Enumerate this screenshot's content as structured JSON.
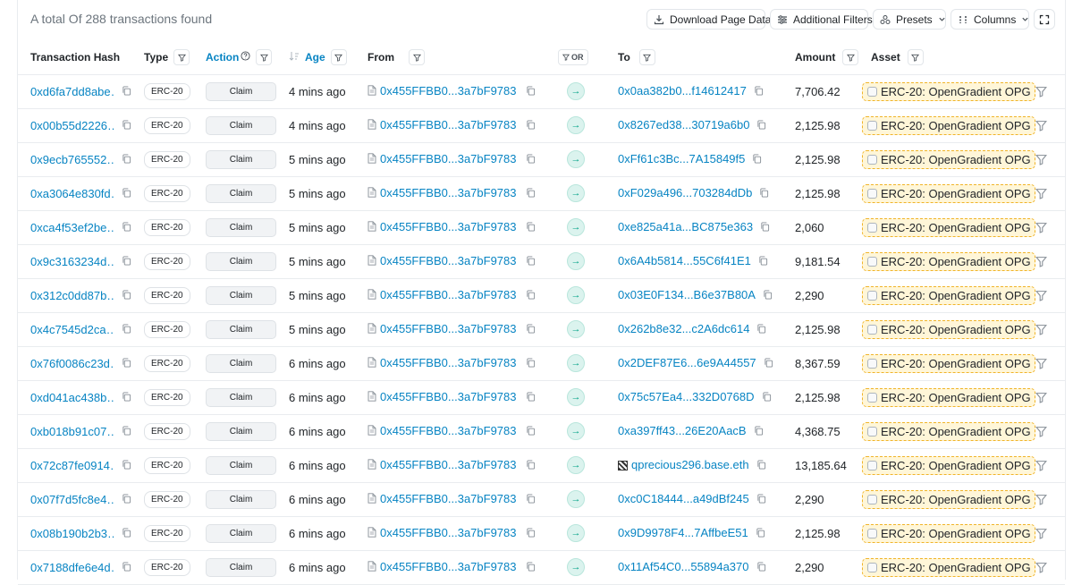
{
  "header": {
    "total_text": "A total Of 288 transactions found",
    "download_label": "Download Page Data",
    "filters_label": "Additional Filters",
    "presets_label": "Presets",
    "columns_label": "Columns"
  },
  "columns": {
    "hash": "Transaction Hash",
    "type": "Type",
    "action": "Action",
    "age": "Age",
    "from": "From",
    "or": "OR",
    "to": "To",
    "amount": "Amount",
    "asset": "Asset"
  },
  "colors": {
    "link": "#0784c3",
    "accent_in": "#00a186",
    "asset_bg": "#fff6d8"
  },
  "rows": [
    {
      "hash": "0xd6fa7dd8abe…",
      "type": "ERC-20",
      "action": "Claim",
      "age": "4 mins ago",
      "from": "0x455FFBB0...3a7bF9783",
      "to": "0x0aa382b0...f14612417",
      "amount": "7,706.42",
      "asset": "ERC-20: OpenGradient OPG"
    },
    {
      "hash": "0x00b55d2226…",
      "type": "ERC-20",
      "action": "Claim",
      "age": "4 mins ago",
      "from": "0x455FFBB0...3a7bF9783",
      "to": "0x8267ed38...30719a6b0",
      "amount": "2,125.98",
      "asset": "ERC-20: OpenGradient OPG"
    },
    {
      "hash": "0x9ecb765552…",
      "type": "ERC-20",
      "action": "Claim",
      "age": "5 mins ago",
      "from": "0x455FFBB0...3a7bF9783",
      "to": "0xFf61c3Bc...7A15849f5",
      "amount": "2,125.98",
      "asset": "ERC-20: OpenGradient OPG"
    },
    {
      "hash": "0xa3064e830fd…",
      "type": "ERC-20",
      "action": "Claim",
      "age": "5 mins ago",
      "from": "0x455FFBB0...3a7bF9783",
      "to": "0xF029a496...703284dDb",
      "amount": "2,125.98",
      "asset": "ERC-20: OpenGradient OPG"
    },
    {
      "hash": "0xca4f53ef2be…",
      "type": "ERC-20",
      "action": "Claim",
      "age": "5 mins ago",
      "from": "0x455FFBB0...3a7bF9783",
      "to": "0xe825a41a...BC875e363",
      "amount": "2,060",
      "asset": "ERC-20: OpenGradient OPG"
    },
    {
      "hash": "0x9c3163234d…",
      "type": "ERC-20",
      "action": "Claim",
      "age": "5 mins ago",
      "from": "0x455FFBB0...3a7bF9783",
      "to": "0x6A4b5814...55C6f41E1",
      "amount": "9,181.54",
      "asset": "ERC-20: OpenGradient OPG"
    },
    {
      "hash": "0x312c0dd87b…",
      "type": "ERC-20",
      "action": "Claim",
      "age": "5 mins ago",
      "from": "0x455FFBB0...3a7bF9783",
      "to": "0x03E0F134...B6e37B80A",
      "amount": "2,290",
      "asset": "ERC-20: OpenGradient OPG"
    },
    {
      "hash": "0x4c7545d2ca…",
      "type": "ERC-20",
      "action": "Claim",
      "age": "5 mins ago",
      "from": "0x455FFBB0...3a7bF9783",
      "to": "0x262b8e32...c2A6dc614",
      "amount": "2,125.98",
      "asset": "ERC-20: OpenGradient OPG"
    },
    {
      "hash": "0x76f0086c23d…",
      "type": "ERC-20",
      "action": "Claim",
      "age": "6 mins ago",
      "from": "0x455FFBB0...3a7bF9783",
      "to": "0x2DEF87E6...6e9A44557",
      "amount": "8,367.59",
      "asset": "ERC-20: OpenGradient OPG"
    },
    {
      "hash": "0xd041ac438b…",
      "type": "ERC-20",
      "action": "Claim",
      "age": "6 mins ago",
      "from": "0x455FFBB0...3a7bF9783",
      "to": "0x75c57Ea4...332D0768D",
      "amount": "2,125.98",
      "asset": "ERC-20: OpenGradient OPG"
    },
    {
      "hash": "0xb018b91c07…",
      "type": "ERC-20",
      "action": "Claim",
      "age": "6 mins ago",
      "from": "0x455FFBB0...3a7bF9783",
      "to": "0xa397ff43...26E20AacB",
      "amount": "4,368.75",
      "asset": "ERC-20: OpenGradient OPG"
    },
    {
      "hash": "0x72c87fe0914…",
      "type": "ERC-20",
      "action": "Claim",
      "age": "6 mins ago",
      "from": "0x455FFBB0...3a7bF9783",
      "to": "qprecious296.base.eth",
      "to_ens": true,
      "amount": "13,185.64",
      "asset": "ERC-20: OpenGradient OPG"
    },
    {
      "hash": "0x07f7d5fc8e4…",
      "type": "ERC-20",
      "action": "Claim",
      "age": "6 mins ago",
      "from": "0x455FFBB0...3a7bF9783",
      "to": "0xc0C18444...a49dBf245",
      "amount": "2,290",
      "asset": "ERC-20: OpenGradient OPG"
    },
    {
      "hash": "0x08b190b2b3…",
      "type": "ERC-20",
      "action": "Claim",
      "age": "6 mins ago",
      "from": "0x455FFBB0...3a7bF9783",
      "to": "0x9D9978F4...7AffbeE51",
      "amount": "2,125.98",
      "asset": "ERC-20: OpenGradient OPG"
    },
    {
      "hash": "0x7188dfe6e4d…",
      "type": "ERC-20",
      "action": "Claim",
      "age": "6 mins ago",
      "from": "0x455FFBB0...3a7bF9783",
      "to": "0x11Af54C0...55894a370",
      "amount": "2,290",
      "asset": "ERC-20: OpenGradient OPG"
    }
  ]
}
